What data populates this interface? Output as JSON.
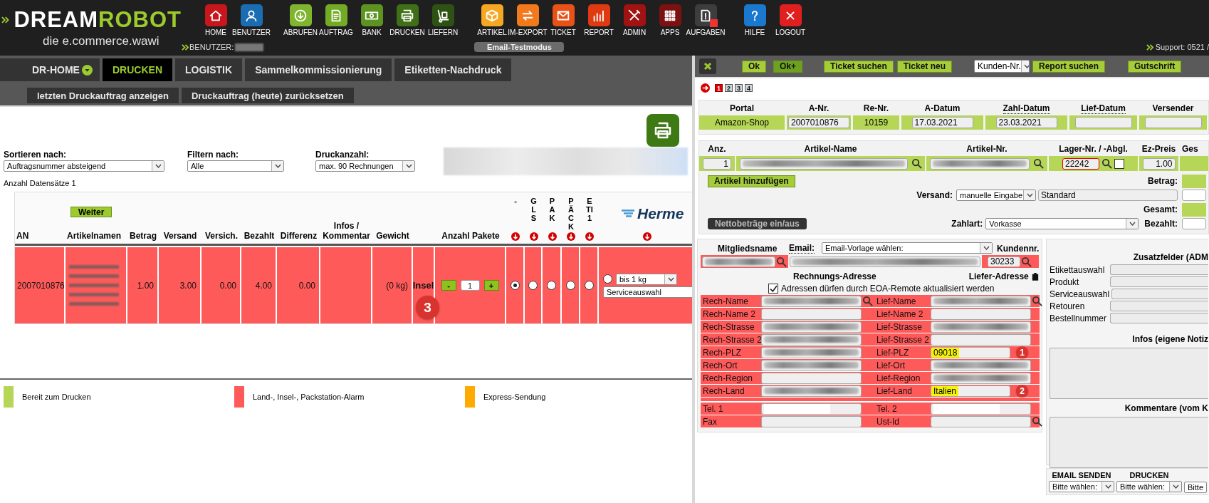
{
  "brand": {
    "word_a": "DREAM",
    "word_b": "ROBOT",
    "tagline": "die e.commerce.wawi"
  },
  "menu_groups": [
    [
      {
        "label": "HOME",
        "color": "#c8161d",
        "alert": false
      },
      {
        "label": "BENUTZER",
        "color": "#1b6db3",
        "alert": false
      }
    ],
    [
      {
        "label": "ABRUFEN",
        "color": "#7fb52f",
        "alert": false
      },
      {
        "label": "AUFTRAG",
        "color": "#74ab26",
        "alert": false
      },
      {
        "label": "BANK",
        "color": "#5d9421",
        "alert": false
      },
      {
        "label": "DRUCKEN",
        "color": "#3f7018",
        "alert": false
      },
      {
        "label": "LIEFERN",
        "color": "#2e5213",
        "alert": false
      }
    ],
    [
      {
        "label": "ARTIKEL",
        "color": "#f7a823",
        "alert": false
      },
      {
        "label": "IM-EXPORT",
        "color": "#f27a1d",
        "alert": false
      },
      {
        "label": "TICKET",
        "color": "#ea5117",
        "alert": false
      },
      {
        "label": "REPORT",
        "color": "#df3a12",
        "alert": false
      },
      {
        "label": "ADMIN",
        "color": "#a11212",
        "alert": false
      },
      {
        "label": "APPS",
        "color": "#7c1111",
        "alert": false
      },
      {
        "label": "AUFGABEN",
        "color": "#3d3d3d",
        "alert": true
      }
    ],
    [
      {
        "label": "HILFE",
        "color": "#1a78cf",
        "alert": false
      },
      {
        "label": "LOGOUT",
        "color": "#e0201f",
        "alert": false
      }
    ]
  ],
  "user_label": "BENUTZER:",
  "user_redacted": true,
  "mode_badge": "Email-Testmodus",
  "support": "Support: 0521 /",
  "left": {
    "tabs": [
      {
        "label": "DR-HOME",
        "selected": false,
        "dropdown": true
      },
      {
        "label": "DRUCKEN",
        "selected": true,
        "dropdown": false
      },
      {
        "label": "LOGISTIK",
        "selected": false,
        "dropdown": false
      },
      {
        "label": "Sammelkommissionierung",
        "selected": false,
        "dropdown": false
      },
      {
        "label": "Etiketten-Nachdruck",
        "selected": false,
        "dropdown": false
      }
    ],
    "subtabs": [
      "letzten Druckauftrag anzeigen",
      "Druckauftrag (heute) zurücksetzen"
    ],
    "filters": [
      {
        "label": "Sortieren nach:",
        "value": "Auftragsnummer absteigend"
      },
      {
        "label": "Filtern nach:",
        "value": "Alle"
      },
      {
        "label": "Druckanzahl:",
        "value": "max. 90 Rechnungen"
      }
    ],
    "banner_redacted": true,
    "record_count": "Anzahl Datensätze 1",
    "continue_button": "Weiter",
    "columns": [
      "AN",
      "Artikelnamen",
      "Betrag",
      "Versand",
      "Versich.",
      "Bezahlt",
      "Differenz",
      "Infos / Kommentar",
      "Gewicht"
    ],
    "packages_header": "Anzahl Pakete",
    "carrier_headers": [
      "-",
      "GLS",
      "PAK",
      "PÄCK",
      "ETI1"
    ],
    "carrier_logo": "Herme",
    "rows": [
      {
        "alarm": true,
        "order_no": "2007010876",
        "articles_redacted": true,
        "amount": "1.00",
        "shipping": "3.00",
        "insurance": "0.00",
        "paid": "4.00",
        "difference": "0.00",
        "weight": "(0 kg)",
        "flag": "Insel",
        "minus": "-",
        "packages": "1",
        "plus": "+",
        "carriers": [
          {
            "selected": true
          },
          {
            "selected": false
          },
          {
            "selected": false
          },
          {
            "selected": false
          },
          {
            "selected": false
          }
        ],
        "hermes": {
          "selected": false,
          "weight": "bis 1 kg",
          "service": "Serviceauswahl"
        },
        "badge": "3"
      }
    ],
    "legend": [
      {
        "label": "Bereit zum Drucken",
        "color": "#b5d656"
      },
      {
        "label": "Land-, Insel-, Packstation-Alarm",
        "color": "#ff5a5a"
      },
      {
        "label": "Express-Sendung",
        "color": "#ffaa00"
      }
    ]
  },
  "right": {
    "toolbar": [
      {
        "kind": "button",
        "label": "Ok",
        "pressed": false
      },
      {
        "kind": "button",
        "label": "Ok+",
        "pressed": true
      },
      {
        "kind": "button",
        "label": "Ticket suchen",
        "pressed": false
      },
      {
        "kind": "button",
        "label": "Ticket neu",
        "pressed": false
      },
      {
        "kind": "dropdown",
        "label": "Kunden-Nr.",
        "pressed": false
      },
      {
        "kind": "button",
        "label": "Report suchen",
        "pressed": false
      },
      {
        "kind": "button",
        "label": "Gutschrift",
        "pressed": false
      }
    ],
    "pages": [
      {
        "label": "1",
        "selected": true
      },
      {
        "label": "2",
        "selected": false
      },
      {
        "label": "3",
        "selected": false
      },
      {
        "label": "4",
        "selected": false
      }
    ],
    "order": {
      "columns": [
        {
          "label": "Portal",
          "hint": false
        },
        {
          "label": "A-Nr.",
          "hint": false
        },
        {
          "label": "Re-Nr.",
          "hint": false
        },
        {
          "label": "A-Datum",
          "hint": false
        },
        {
          "label": "Zahl-Datum",
          "hint": true
        },
        {
          "label": "Lief-Datum",
          "hint": true
        },
        {
          "label": "Versender",
          "hint": false
        }
      ],
      "values": [
        {
          "kind": "text",
          "value": "Amazon-Shop"
        },
        {
          "kind": "field",
          "value": "2007010876"
        },
        {
          "kind": "text",
          "value": "10159"
        },
        {
          "kind": "field",
          "value": "17.03.2021"
        },
        {
          "kind": "field",
          "value": "23.03.2021"
        },
        {
          "kind": "field"
        },
        {
          "kind": "field"
        }
      ]
    },
    "articles": {
      "columns": [
        "Anz.",
        "Artikel-Name",
        "Artikel-Nr.",
        "Lager-Nr. / -Abgl.",
        "Ez-Preis",
        "Ges"
      ],
      "rows": [
        {
          "qty": "1",
          "name_redacted": true,
          "sku_redacted": true,
          "stock": "22242",
          "stock_error": true,
          "reconciled": false,
          "price": "1.00"
        }
      ],
      "add_button": "Artikel hinzufügen",
      "net_toggle": "Nettobeträge ein/aus",
      "amount_label": "Betrag:",
      "shipping_label": "Versand:",
      "shipping_mode": "manuelle Eingabe",
      "shipping_service": "Standard",
      "total_label": "Gesamt:",
      "payment_label": "Zahlart:",
      "payment_method": "Vorkasse",
      "paid_label": "Bezahlt:"
    },
    "customer": {
      "member_label": "Mitgliedsname",
      "member_redacted": true,
      "email_label": "Email:",
      "email_template": "Email-Vorlage wählen:",
      "email_redacted": true,
      "customer_no_label": "Kundennr.",
      "customer_no": "30233",
      "billing_title": "Rechnungs-Adresse",
      "shipping_title": "Liefer-Adresse",
      "remote_update": {
        "label": "Adressen dürfen durch EOA-Remote aktualisiert werden",
        "checked": true
      },
      "address_rows": [
        {
          "bill_label": "Rech-Name",
          "bill_redacted": true,
          "bill_search": true,
          "ship_label": "Lief-Name",
          "ship": {
            "redacted": true,
            "highlight": false
          },
          "ship_search": true
        },
        {
          "bill_label": "Rech-Name 2",
          "bill_redacted": false,
          "bill_search": false,
          "ship_label": "Lief-Name 2",
          "ship": {
            "redacted": false,
            "highlight": false
          },
          "ship_search": false
        },
        {
          "bill_label": "Rech-Strasse",
          "bill_redacted": true,
          "bill_search": false,
          "ship_label": "Lief-Strasse",
          "ship": {
            "redacted": true,
            "highlight": false
          },
          "ship_search": false
        },
        {
          "bill_label": "Rech-Strasse 2",
          "bill_redacted": true,
          "bill_search": false,
          "ship_label": "Lief-Strasse 2",
          "ship": {
            "redacted": false,
            "highlight": false
          },
          "ship_search": false
        },
        {
          "bill_label": "Rech-PLZ",
          "bill_redacted": true,
          "bill_search": false,
          "ship_label": "Lief-PLZ",
          "ship": {
            "value": "09018",
            "redacted": false,
            "highlight": true
          },
          "ship_search": false,
          "badge": "1"
        },
        {
          "bill_label": "Rech-Ort",
          "bill_redacted": true,
          "bill_search": false,
          "ship_label": "Lief-Ort",
          "ship": {
            "redacted": true,
            "highlight": false
          },
          "ship_search": false
        },
        {
          "bill_label": "Rech-Region",
          "bill_redacted": false,
          "bill_search": false,
          "ship_label": "Lief-Region",
          "ship": {
            "redacted": true,
            "highlight": false
          },
          "ship_search": false
        },
        {
          "bill_label": "Rech-Land",
          "bill_redacted": true,
          "bill_search": false,
          "ship_label": "Lief-Land",
          "ship": {
            "value": "Italien",
            "redacted": false,
            "highlight": true
          },
          "ship_search": false,
          "badge": "2"
        }
      ],
      "contact_rows": [
        {
          "left_label": "Tel. 1",
          "left_redacted": true,
          "right_label": "Tel. 2",
          "right_redacted": true,
          "right_search": false
        },
        {
          "left_label": "Fax",
          "left_redacted": false,
          "right_label": "Ust-Id",
          "right_redacted": false,
          "right_search": true
        }
      ]
    },
    "extra": {
      "title": "Zusatzfelder (ADM",
      "fields": [
        "Etikettauswahl",
        "Produkt",
        "Serviceauswahl",
        "Retouren",
        "Bestellnummer"
      ],
      "notes_title": "Infos (eigene Notiz",
      "comments_title": "Kommentare (vom K"
    },
    "actions": [
      {
        "title": "EMAIL SENDEN",
        "choice": "Bitte wählen:"
      },
      {
        "title": "DRUCKEN",
        "choice": "Bitte wählen:"
      },
      {
        "choice": "Bitte"
      }
    ]
  }
}
